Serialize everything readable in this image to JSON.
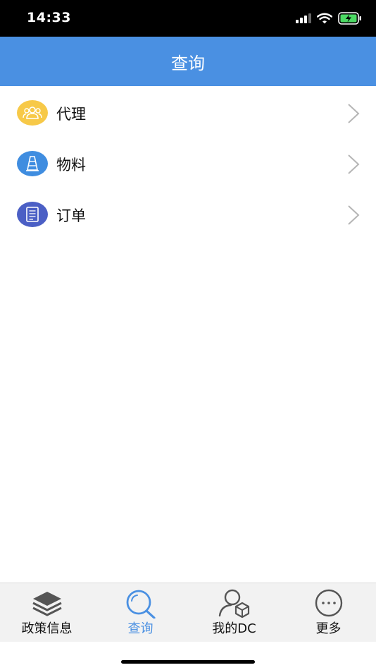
{
  "status_bar": {
    "time": "14:33",
    "icons": [
      "signal-icon",
      "wifi-icon",
      "battery-charging-icon"
    ]
  },
  "nav": {
    "title": "查询"
  },
  "menu": {
    "items": [
      {
        "label": "代理",
        "icon": "users-icon",
        "color": "#f7c948"
      },
      {
        "label": "物料",
        "icon": "cone-icon",
        "color": "#3f8de0"
      },
      {
        "label": "订单",
        "icon": "document-icon",
        "color": "#4b5fc5"
      }
    ]
  },
  "tabs": [
    {
      "label": "政策信息",
      "icon": "layers-icon",
      "active": false
    },
    {
      "label": "查询",
      "icon": "search-icon",
      "active": true
    },
    {
      "label": "我的DC",
      "icon": "user-box-icon",
      "active": false
    },
    {
      "label": "更多",
      "icon": "more-icon",
      "active": false
    }
  ],
  "colors": {
    "accent": "#4a90e2",
    "tab_bar_bg": "#f2f2f2"
  }
}
